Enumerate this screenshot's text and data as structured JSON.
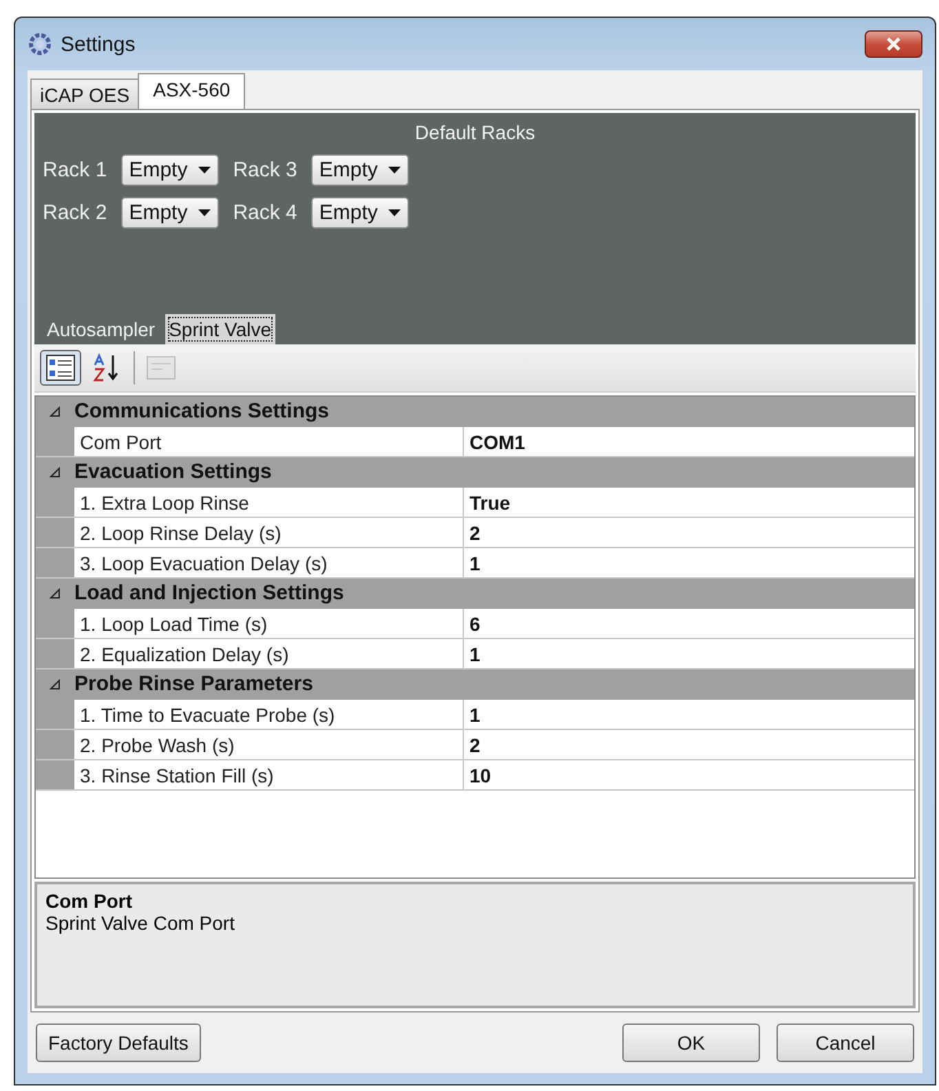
{
  "window": {
    "title": "Settings"
  },
  "tabs": [
    {
      "label": "iCAP OES",
      "selected": false
    },
    {
      "label": "ASX-560",
      "selected": true
    }
  ],
  "default_racks": {
    "title": "Default Racks",
    "racks": [
      {
        "label": "Rack 1",
        "value": "Empty"
      },
      {
        "label": "Rack 3",
        "value": "Empty"
      },
      {
        "label": "Rack 2",
        "value": "Empty"
      },
      {
        "label": "Rack 4",
        "value": "Empty"
      }
    ]
  },
  "inner_tabs": [
    {
      "label": "Autosampler",
      "selected": false
    },
    {
      "label": "Sprint Valve",
      "selected": true
    }
  ],
  "toolbar": [
    {
      "kind": "categorized",
      "selected": true,
      "disabled": false
    },
    {
      "kind": "alphabetical",
      "selected": false,
      "disabled": false
    },
    {
      "kind": "property_pages",
      "selected": false,
      "disabled": true
    }
  ],
  "categories": [
    {
      "name": "Communications Settings",
      "expanded": true,
      "properties": [
        {
          "name": "Com Port",
          "value": "COM1"
        }
      ]
    },
    {
      "name": "Evacuation Settings",
      "expanded": true,
      "properties": [
        {
          "name": "1. Extra Loop Rinse",
          "value": "True"
        },
        {
          "name": "2. Loop Rinse Delay (s)",
          "value": "2"
        },
        {
          "name": "3. Loop Evacuation Delay (s)",
          "value": "1"
        }
      ]
    },
    {
      "name": "Load and Injection Settings",
      "expanded": true,
      "properties": [
        {
          "name": "1. Loop Load Time (s)",
          "value": "6"
        },
        {
          "name": "2. Equalization Delay (s)",
          "value": "1"
        }
      ]
    },
    {
      "name": "Probe Rinse Parameters",
      "expanded": true,
      "properties": [
        {
          "name": "1. Time to Evacuate Probe (s)",
          "value": "1"
        },
        {
          "name": "2. Probe Wash (s)",
          "value": "2"
        },
        {
          "name": "3. Rinse Station Fill (s)",
          "value": "10"
        }
      ]
    }
  ],
  "description": {
    "title": "Com Port",
    "text": "Sprint Valve Com Port"
  },
  "buttons": [
    {
      "label": "Factory Defaults"
    },
    {
      "label": "OK"
    },
    {
      "label": "Cancel"
    }
  ]
}
